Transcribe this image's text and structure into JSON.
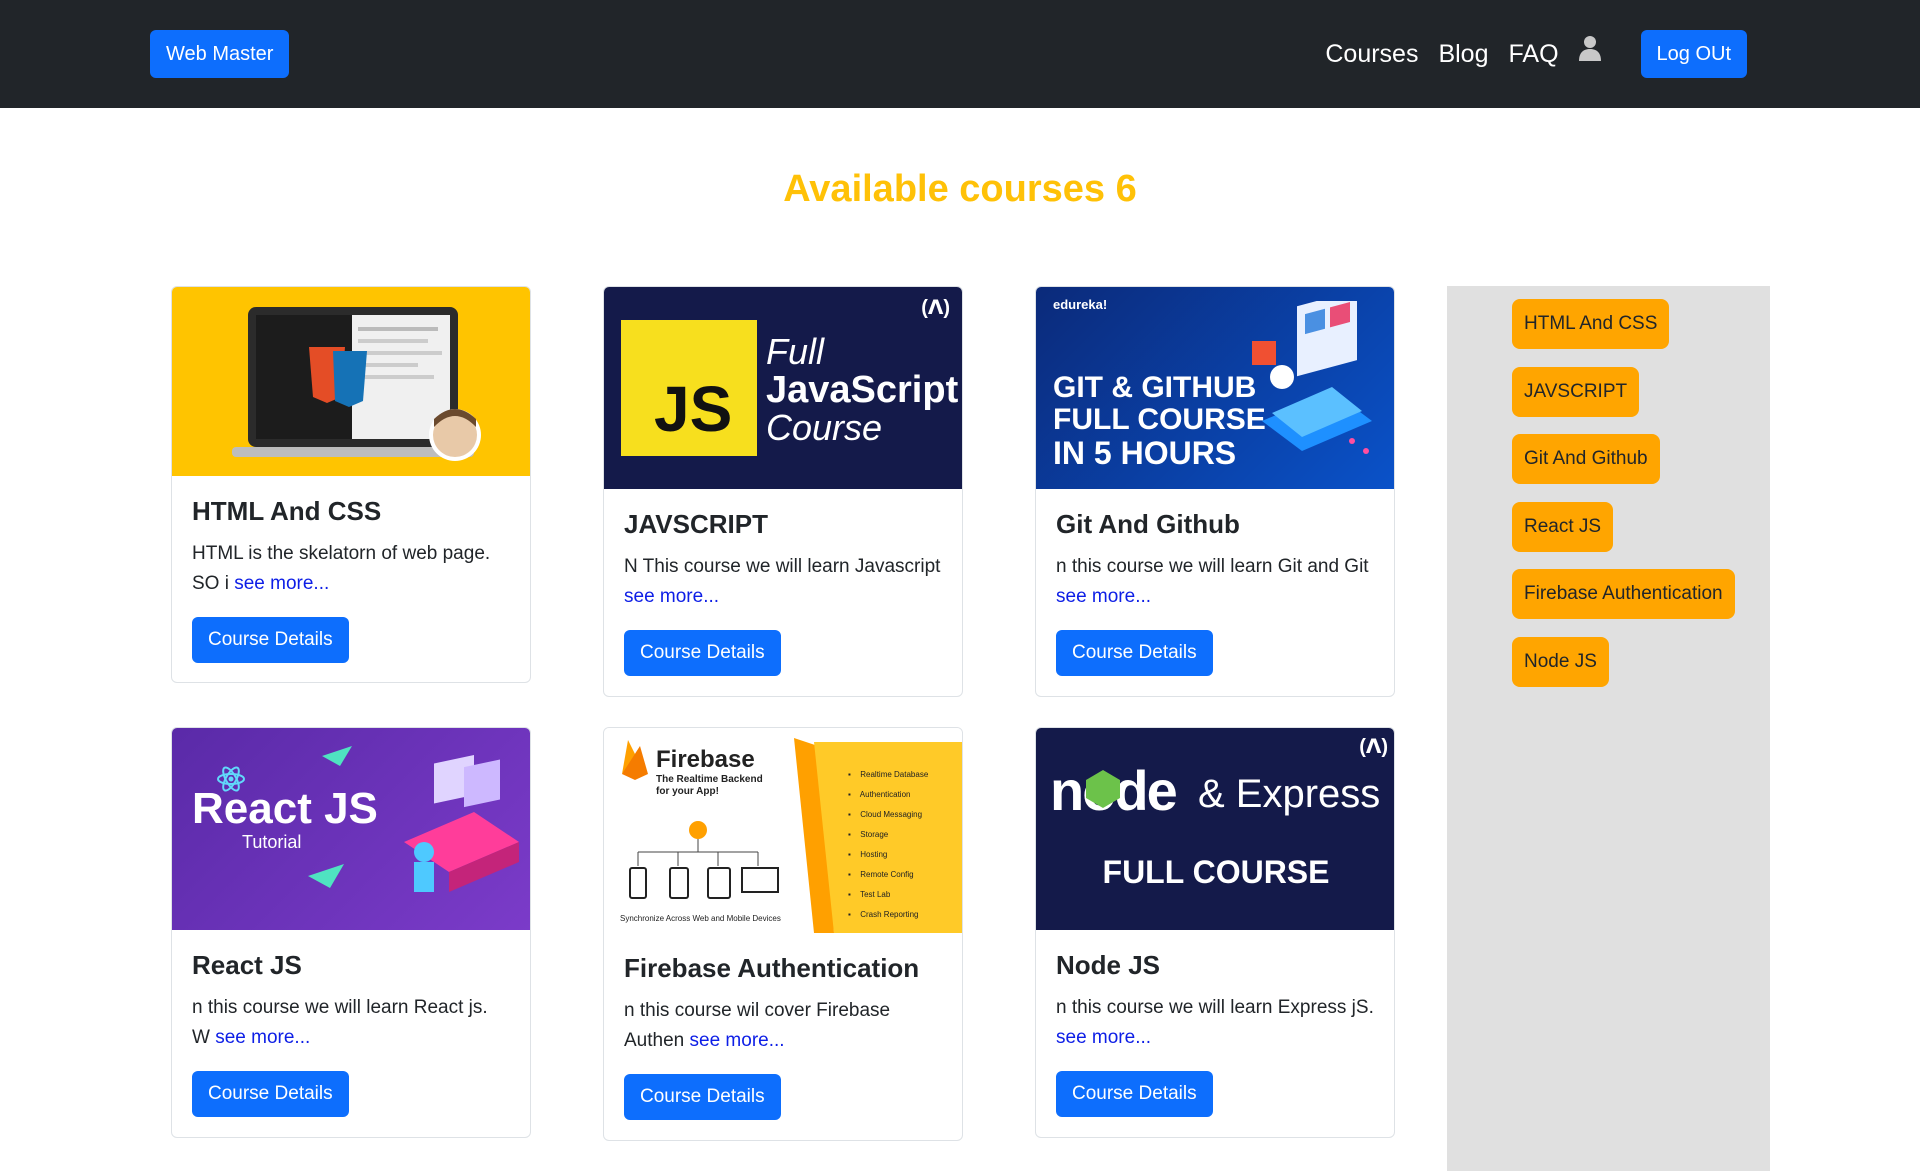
{
  "navbar": {
    "brand": "Web Master",
    "links": [
      "Courses",
      "Blog",
      "FAQ"
    ],
    "logout_label": "Log OUt"
  },
  "page": {
    "title": "Available courses 6"
  },
  "courses": [
    {
      "title": "HTML And CSS",
      "desc": "HTML is the skelatorn of web page. SO i",
      "more": "see more...",
      "button": "Course Details"
    },
    {
      "title": "JAVSCRIPT",
      "desc": "N This course we will learn Javascript",
      "more": "see more...",
      "button": "Course Details",
      "img_text": {
        "js": "JS",
        "line1": "Full",
        "line2": "JavaScript",
        "line3": "Course"
      }
    },
    {
      "title": "Git And Github",
      "desc": "n this course we will learn Git and Git",
      "more": "see more...",
      "button": "Course Details",
      "img_text": {
        "brand": "edureka!",
        "line1": "GIT & GITHUB",
        "line2": "FULL COURSE",
        "line3": "IN 5 HOURS"
      }
    },
    {
      "title": "React JS",
      "desc": "n this course we will learn React js. W",
      "more": "see more...",
      "button": "Course Details",
      "img_text": {
        "line1": "React JS",
        "line2": "Tutorial"
      }
    },
    {
      "title": "Firebase Authentication",
      "desc": "n this course wil cover Firebase Authen",
      "more": "see more...",
      "button": "Course Details",
      "img_text": {
        "brand": "Firebase",
        "tagline": "The Realtime Backend for your App!",
        "caption": "Synchronize Across Web and Mobile Devices",
        "features": [
          "Realtime Database",
          "Authentication",
          "Cloud Messaging",
          "Storage",
          "Hosting",
          "Remote Config",
          "Test Lab",
          "Crash Reporting"
        ]
      }
    },
    {
      "title": "Node JS",
      "desc": "n this course we will learn Express jS.",
      "more": "see more...",
      "button": "Course Details",
      "img_text": {
        "node": "node",
        "express": "& Express",
        "line2": "FULL COURSE"
      }
    }
  ],
  "sidebar": {
    "items": [
      "HTML And CSS",
      "JAVSCRIPT",
      "Git And Github",
      "React JS",
      "Firebase Authentication",
      "Node JS"
    ]
  },
  "colors": {
    "navbar": "#212529",
    "primary": "#0d6efd",
    "title": "#ffc107",
    "sidebar_item": "#ffa500",
    "sidebar_bg": "#e0e0e0"
  }
}
